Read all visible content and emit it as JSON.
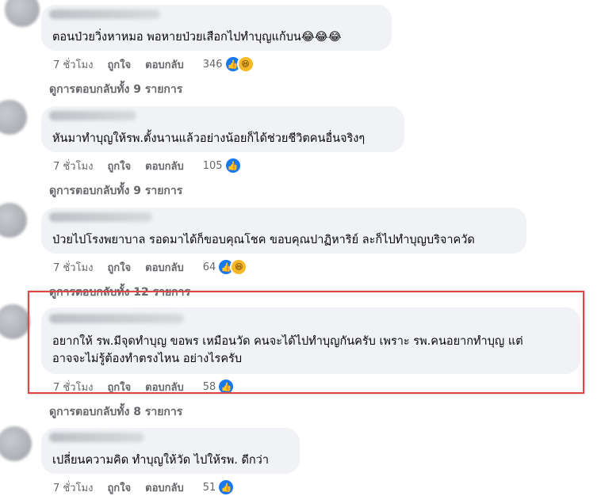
{
  "comments": [
    {
      "text": "ตอนป่วยวิ่งหาหมอ พอหายป่วยเสือกไปทำบุญแก้บน😂😂😂",
      "time": "7 ชั่วโมง",
      "like_label": "ถูกใจ",
      "reply_label": "ตอบกลับ",
      "reaction_count": "346",
      "reactions": [
        "like-icon",
        "haha-icon"
      ],
      "view_replies": "ดูการตอบกลับทั้ง 9 รายการ"
    },
    {
      "text": "หันมาทำบุญให้รพ.ตั้งนานแล้วอย่างน้อยก็ได้ช่วยชีวิตคนอื่นจริงๆ",
      "time": "7 ชั่วโมง",
      "like_label": "ถูกใจ",
      "reply_label": "ตอบกลับ",
      "reaction_count": "105",
      "reactions": [
        "like-icon"
      ],
      "view_replies": "ดูการตอบกลับทั้ง 9 รายการ"
    },
    {
      "text": "ป่วยไปโรงพยาบาล รอดมาได้ก็ขอบคุณโชค ขอบคุณปาฏิหาริย์ ละก็ไปทำบุญบริจาควัด",
      "time": "7 ชั่วโมง",
      "like_label": "ถูกใจ",
      "reply_label": "ตอบกลับ",
      "reaction_count": "64",
      "reactions": [
        "like-icon",
        "haha-icon"
      ],
      "view_replies": "ดูการตอบกลับทั้ง 12 รายการ"
    },
    {
      "text_line1": "อยากให้ รพ.มีจุดทำบุญ ขอพร เหมือนวัด คนจะได้ไปทำบุญกันครับ เพราะ รพ.คนอยากทำบุญ แต่",
      "text_line2": "อาจจะไม่รู้ต้องทำตรงไหน อย่างไรครับ",
      "time": "7 ชั่วโมง",
      "like_label": "ถูกใจ",
      "reply_label": "ตอบกลับ",
      "reaction_count": "58",
      "reactions": [
        "like-icon"
      ],
      "view_replies": "ดูการตอบกลับทั้ง 8 รายการ"
    },
    {
      "text": "เปลี่ยนความคิด ทำบุญให้วัด ไปให้รพ. ดีกว่า",
      "time": "7 ชั่วโมง",
      "like_label": "ถูกใจ",
      "reply_label": "ตอบกลับ",
      "reaction_count": "51",
      "reactions": [
        "like-icon"
      ]
    }
  ],
  "colors": {
    "bubble": "#f0f2f5",
    "secondary_text": "#65676b",
    "like_blue": "#1877f2",
    "highlight_red": "#e04646"
  }
}
